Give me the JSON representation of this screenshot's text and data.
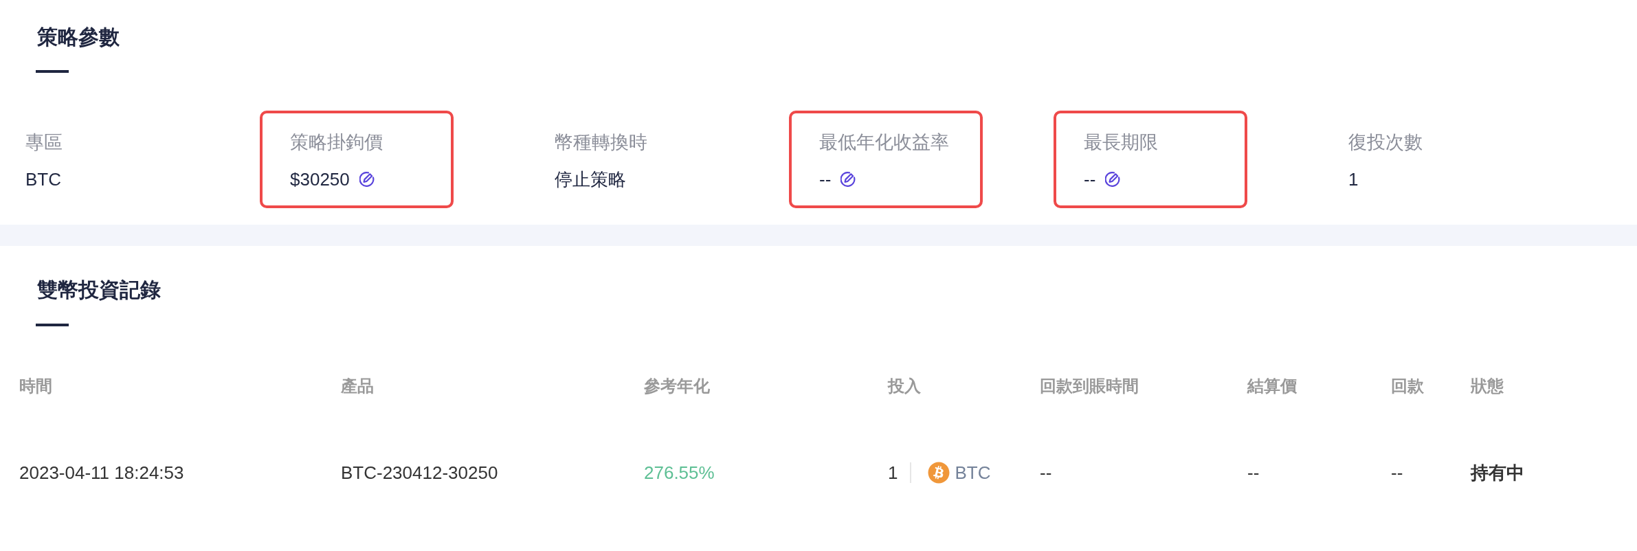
{
  "strategy_params": {
    "title": "策略參數",
    "items": [
      {
        "label": "專區",
        "value": "BTC",
        "editable": false,
        "highlighted": false
      },
      {
        "label": "策略掛鉤價",
        "value": "$30250",
        "editable": true,
        "highlighted": true
      },
      {
        "label": "幣種轉換時",
        "value": "停止策略",
        "editable": false,
        "highlighted": false
      },
      {
        "label": "最低年化收益率",
        "value": "--",
        "editable": true,
        "highlighted": true
      },
      {
        "label": "最長期限",
        "value": "--",
        "editable": true,
        "highlighted": true
      },
      {
        "label": "復投次數",
        "value": "1",
        "editable": false,
        "highlighted": false
      }
    ]
  },
  "investment_records": {
    "title": "雙幣投資記錄",
    "columns": [
      "時間",
      "產品",
      "參考年化",
      "投入",
      "回款到賬時間",
      "結算價",
      "回款",
      "狀態"
    ],
    "rows": [
      {
        "cells": [
          {
            "kind": "text",
            "text": "2023-04-11 18:24:53"
          },
          {
            "kind": "text",
            "text": "BTC-230412-30250"
          },
          {
            "kind": "yield",
            "text": "276.55%"
          },
          {
            "kind": "amount",
            "amount": "1",
            "currency": "BTC"
          },
          {
            "kind": "text",
            "text": "--"
          },
          {
            "kind": "text",
            "text": "--"
          },
          {
            "kind": "text",
            "text": "--"
          },
          {
            "kind": "status",
            "text": "持有中"
          }
        ]
      }
    ]
  }
}
